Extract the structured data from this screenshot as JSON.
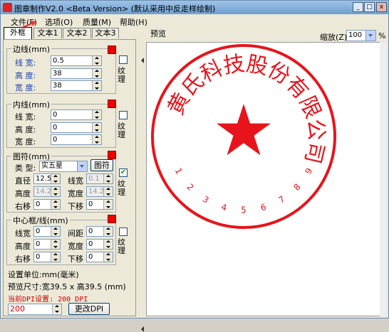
{
  "window": {
    "title": "图章制作V2.0 <Beta Version> (默认采用中反走样绘制)",
    "min_btn": "_",
    "max_btn": "□",
    "close_btn": "x"
  },
  "menu": [
    "文件(F)",
    "选项(O)",
    "质量(M)",
    "帮助(H)"
  ],
  "tabs": [
    "外框",
    "文本1",
    "文本2",
    "文本3"
  ],
  "border_group": {
    "title": "边线(mm)",
    "labels": [
      "线 宽:",
      "高 度:",
      "宽 度:"
    ],
    "values": [
      "0.5",
      "38",
      "38"
    ],
    "checkbox_label": "纹理",
    "checked": false
  },
  "inner_group": {
    "title": "内线(mm)",
    "labels": [
      "线 宽:",
      "高 度:",
      "宽 度:"
    ],
    "values": [
      "0",
      "0",
      "0"
    ],
    "checkbox_label": "纹理",
    "checked": false
  },
  "symbol_group": {
    "title": "图符(mm)",
    "type_label": "类 型:",
    "type_value": "实五星",
    "symbol_button": "图符",
    "diameter_label": "直径",
    "diameter_value": "12.5",
    "linewidth_label": "线宽",
    "linewidth_value": "0.1",
    "height_label": "高度",
    "height_value": "14.2",
    "width_label": "宽度",
    "width_value": "14.2",
    "right_label": "右移",
    "right_value": "0",
    "down_label": "下移",
    "down_value": "0",
    "checkbox_label": "纹理",
    "checked": true
  },
  "center_group": {
    "title": "中心框/线(mm)",
    "linewidth_label": "线宽",
    "linewidth_value": "0",
    "spacing_label": "间距",
    "spacing_value": "0",
    "height_label": "高度",
    "height_value": "0",
    "width_label": "宽度",
    "width_value": "0",
    "right_label": "右移",
    "right_value": "0",
    "down_label": "下移",
    "down_value": "0",
    "checkbox_label": "纹理",
    "checked": false
  },
  "footer": {
    "unit_text": "设置单位:mm(毫米)",
    "size_text": "预览尺寸:宽39.5 x 高39.5 (mm)",
    "dpi_text": "当前DPI设置: 200 DPI",
    "dpi_value": "200",
    "change_dpi_button": "更改DPI"
  },
  "preview": {
    "label": "预览",
    "zoom_label": "缩放(Z)",
    "zoom_value": "100",
    "zoom_unit": "%"
  },
  "stamp": {
    "company_chars": [
      "黄",
      "氏",
      "科",
      "技",
      "股",
      "份",
      "有",
      "限",
      "公",
      "司"
    ],
    "numbers": [
      "1",
      "2",
      "3",
      "4",
      "5",
      "6",
      "7",
      "8",
      "9"
    ],
    "color": "#e8141b"
  }
}
